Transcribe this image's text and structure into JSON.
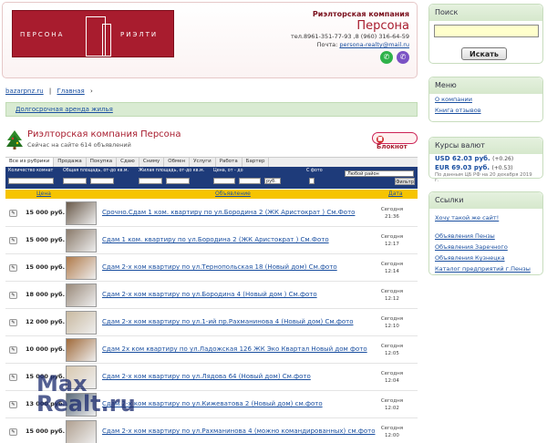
{
  "header": {
    "logo_left": "ПЕРСОНА",
    "logo_right": "РИЭЛТИ",
    "company_kind": "Риэлторская компания",
    "company_name": "Персона",
    "phones": "тел.8961-351-77-93 ,8 (960) 316-64-59",
    "mail_label": "Почта:",
    "mail_value": "persona-realty@mail.ru"
  },
  "breadcrumbs": [
    "bazarpnz.ru",
    "Главная"
  ],
  "category_bar": "Долгосрочная аренда жилья",
  "catalog": {
    "title": "Риэлторская компания Персона",
    "subtitle": "Сейчас на сайте 614 объявлений",
    "notebook": "Блокнот"
  },
  "tabs": [
    "Все из рубрики",
    "Продажа",
    "Покупка",
    "Сдаю",
    "Сниму",
    "Обмен",
    "Услуги",
    "Работа",
    "Бартер"
  ],
  "filters": {
    "rooms": "Количество комнат",
    "area": "Общая площадь, от-до кв.м.",
    "living": "Жилая площадь, от-до кв.м.",
    "price": "Цена, от - до",
    "currency": "руб.",
    "photo": "С фото",
    "district": "Любой район",
    "from": "от",
    "to": "до",
    "submit": "Фильтр"
  },
  "table_head": {
    "price": "Цена",
    "object": "Объявление",
    "date": "Дата"
  },
  "listings": [
    {
      "price": "15 000 руб.",
      "title": "Срочно.Сдам 1 ком. квартиру по ул.Бородина 2 (ЖК Аристократ ) См.Фото",
      "day": "Сегодня",
      "time": "21:36"
    },
    {
      "price": "15 000 руб.",
      "title": "Сдам 1 ком. квартиру по ул.Бородина 2 (ЖК Аристократ ) См.Фото",
      "day": "Сегодня",
      "time": "12:17"
    },
    {
      "price": "15 000 руб.",
      "title": "Сдам 2-х ком квартиру по ул.Тернопольская 18 (Новый дом) См.фото",
      "day": "Сегодня",
      "time": "12:14"
    },
    {
      "price": "18 000 руб.",
      "title": "Сдам 2-х ком квартиру по ул.Бородина 4 (Новый дом ) См.фото",
      "day": "Сегодня",
      "time": "12:12"
    },
    {
      "price": "12 000 руб.",
      "title": "Сдам 2-х ком квартиру по ул.1-ий пр.Рахманинова 4 (Новый дом) См.фото",
      "day": "Сегодня",
      "time": "12:10"
    },
    {
      "price": "10 000 руб.",
      "title": "Сдам 2х ком квартиру по ул.Ладожская 126 ЖК Эко Квартал Новый дом фото",
      "day": "Сегодня",
      "time": "12:05"
    },
    {
      "price": "15 000 руб.",
      "title": "Сдам 2-х ком квартиру по ул.Лядова 64 (Новый дом) См.фото",
      "day": "Сегодня",
      "time": "12:04"
    },
    {
      "price": "13 000 руб.",
      "title": "Сдам 2-х ком квартиру по ул.Кижеватова 2 (Новый дом) см.фото",
      "day": "Сегодня",
      "time": "12:02"
    },
    {
      "price": "15 000 руб.",
      "title": "Сдам 2-х ком квартиру по ул.Рахманинова 4 (можно командированных) см.фото",
      "day": "Сегодня",
      "time": "12:00"
    }
  ],
  "watermark": {
    "line1": "Max",
    "line2": "Realt.ru"
  },
  "search": {
    "title": "Поиск",
    "button": "Искать",
    "value": ""
  },
  "menu": {
    "title": "Меню",
    "items": [
      "О компании",
      "Книга отзывов"
    ]
  },
  "rates": {
    "title": "Курсы валют",
    "usd": "USD  62.03 руб.",
    "usd_chg": "(+0.26)",
    "eur": "EUR  69.03 руб.",
    "eur_chg": "(+0.53)",
    "note": "По данным ЦБ РФ на 20 декабря 2019 г."
  },
  "links": {
    "title": "Ссылки",
    "items": [
      "Хочу такой же сайт!",
      "Объявления Пензы",
      "Объявления Заречного",
      "Объявления Кузнецка",
      "Каталог предприятий г.Пензы"
    ]
  },
  "colors": {
    "brand": "#a81c2e",
    "filter_bar": "#1e3b7a",
    "table_head": "#f6c400",
    "panel_head": "#d6e8cd"
  }
}
